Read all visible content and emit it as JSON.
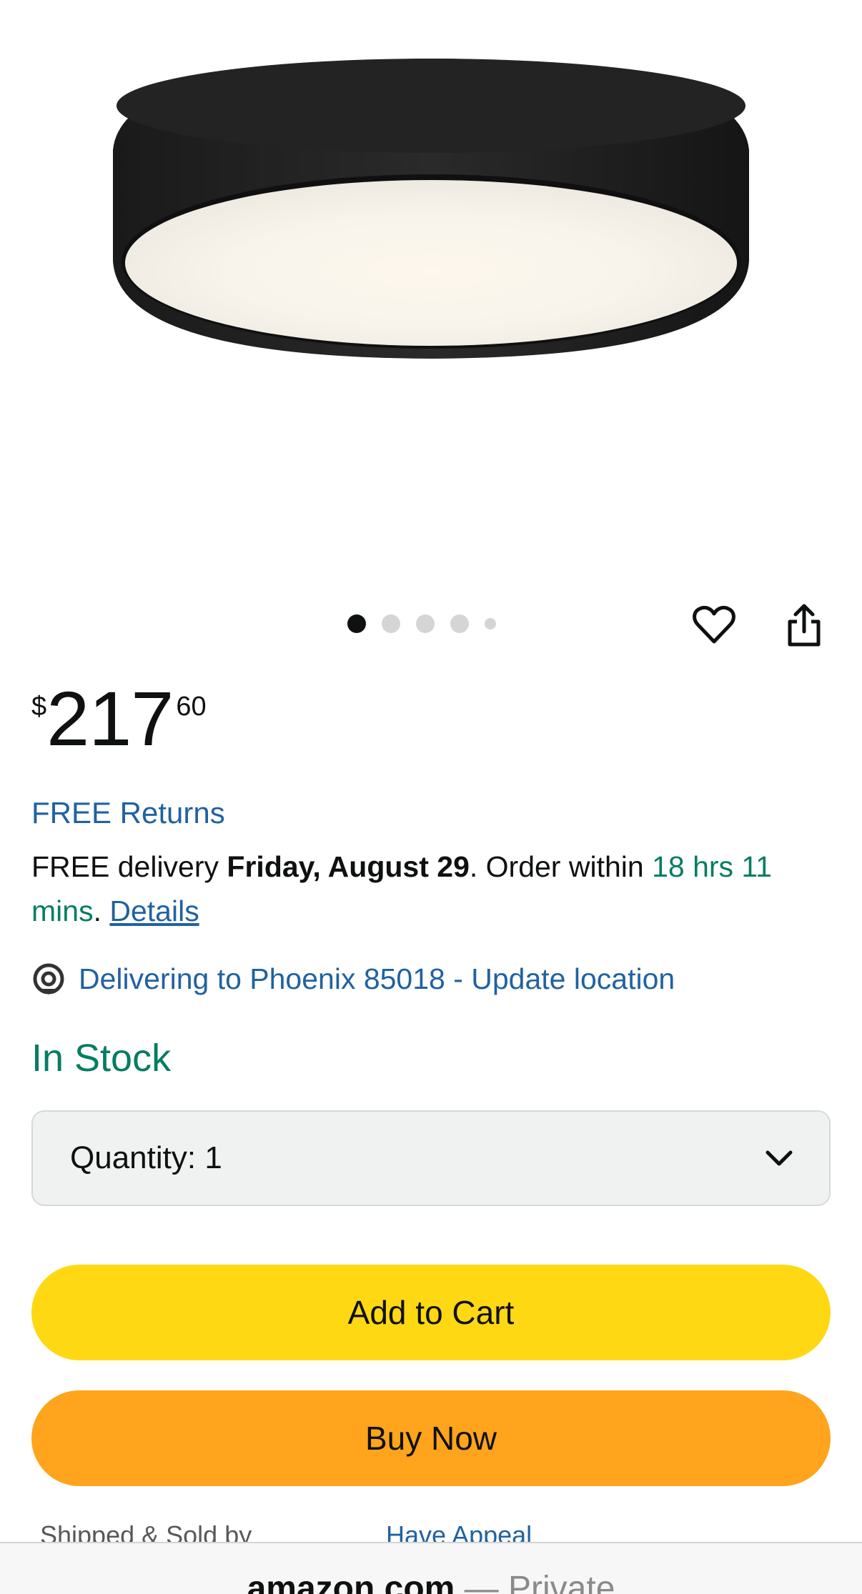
{
  "carousel": {
    "total": 5,
    "active_index": 0
  },
  "price": {
    "symbol": "$",
    "whole": "217",
    "fraction": "60"
  },
  "returns": {
    "label": "FREE Returns"
  },
  "delivery": {
    "prefix": "FREE delivery ",
    "date": "Friday, August 29",
    "mid": ". Order within ",
    "countdown": "18 hrs 11 mins",
    "dot": ". ",
    "details_link": "Details"
  },
  "location": {
    "text": "Delivering to Phoenix 85018 - Update location",
    "icon": "location-pin-icon"
  },
  "stock": {
    "status": "In Stock"
  },
  "quantity": {
    "label": "Quantity:",
    "value": "1",
    "icon": "chevron-down-icon"
  },
  "buttons": {
    "add_to_cart": "Add to Cart",
    "buy_now": "Buy Now"
  },
  "partial": {
    "shipped_sold": "Shipped & Sold by",
    "have_appeal": "Have Appeal"
  },
  "browser": {
    "domain": "amazon.com",
    "separator": " — ",
    "mode": "Private"
  },
  "colors": {
    "link": "#2162a1",
    "green": "#067d62",
    "add_to_cart": "#ffd814",
    "buy_now": "#ffa41c",
    "quantity_bg": "#f0f2f2"
  }
}
